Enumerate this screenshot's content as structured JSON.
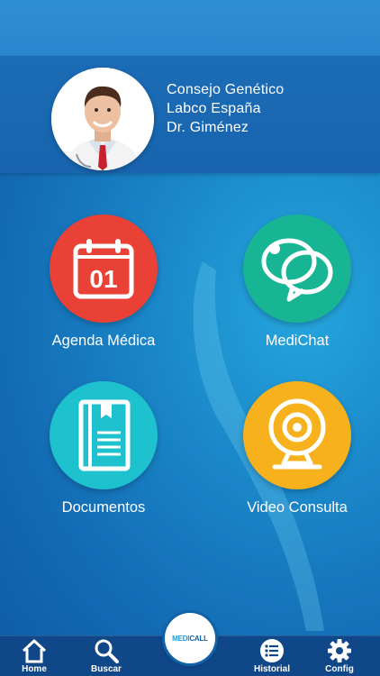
{
  "header": {
    "line1": "Consejo Genético",
    "line2": "Labco España",
    "line3": "Dr. Giménez"
  },
  "tiles": [
    {
      "label": "Agenda Médica",
      "icon": "calendar-icon",
      "icon_text": "01",
      "color": "#ea4136"
    },
    {
      "label": "MediChat",
      "icon": "chat-bubbles-icon",
      "color": "#17b594"
    },
    {
      "label": "Documentos",
      "icon": "document-icon",
      "color": "#1ec2cf"
    },
    {
      "label": "Video Consulta",
      "icon": "webcam-icon",
      "color": "#f6b11c"
    }
  ],
  "nav": {
    "home": "Home",
    "buscar": "Buscar",
    "historial": "Historial",
    "config": "Config",
    "center_logo_a": "MEDI",
    "center_logo_b": "CALL"
  },
  "colors": {
    "background": "#1a87c9",
    "navbar": "#0f4789"
  }
}
